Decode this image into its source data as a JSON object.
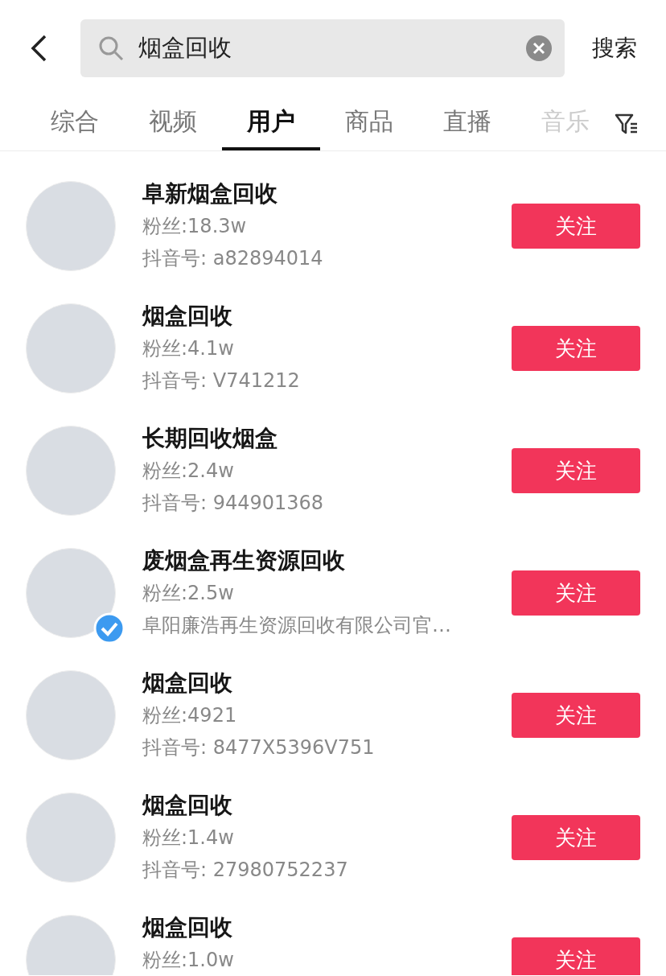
{
  "search": {
    "value": "烟盒回收",
    "button": "搜索"
  },
  "tabs": [
    {
      "label": "综合",
      "selected": false,
      "faded": false
    },
    {
      "label": "视频",
      "selected": false,
      "faded": false
    },
    {
      "label": "用户",
      "selected": true,
      "faded": false
    },
    {
      "label": "商品",
      "selected": false,
      "faded": false
    },
    {
      "label": "直播",
      "selected": false,
      "faded": false
    },
    {
      "label": "音乐",
      "selected": false,
      "faded": true
    }
  ],
  "users": [
    {
      "name": "阜新烟盒回收",
      "followers": "粉丝:18.3w",
      "subtitle": "抖音号: a82894014",
      "verified": false,
      "follow": "关注"
    },
    {
      "name": "烟盒回收",
      "followers": "粉丝:4.1w",
      "subtitle": "抖音号: V741212",
      "verified": false,
      "follow": "关注"
    },
    {
      "name": "长期回收烟盒",
      "followers": "粉丝:2.4w",
      "subtitle": "抖音号: 944901368",
      "verified": false,
      "follow": "关注"
    },
    {
      "name": "废烟盒再生资源回收",
      "followers": "粉丝:2.5w",
      "subtitle": "阜阳廉浩再生资源回收有限公司官…",
      "verified": true,
      "follow": "关注"
    },
    {
      "name": "烟盒回收",
      "followers": "粉丝:4921",
      "subtitle": "抖音号: 8477X5396V751",
      "verified": false,
      "follow": "关注"
    },
    {
      "name": "烟盒回收",
      "followers": "粉丝:1.4w",
      "subtitle": "抖音号: 27980752237",
      "verified": false,
      "follow": "关注"
    },
    {
      "name": "烟盒回收",
      "followers": "粉丝:1.0w",
      "verified": false,
      "follow": "关注"
    }
  ]
}
